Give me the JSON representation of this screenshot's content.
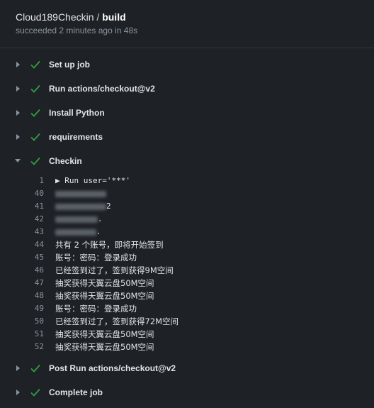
{
  "header": {
    "repo": "Cloud189Checkin",
    "separator": "/",
    "workflow": "build",
    "status": "succeeded 2 minutes ago in 48s"
  },
  "colors": {
    "success": "#2ea043",
    "background": "#1e2227"
  },
  "steps_before": [
    {
      "label": "Set up job",
      "icon": "check-icon"
    },
    {
      "label": "Run actions/checkout@v2",
      "icon": "check-icon"
    },
    {
      "label": "Install Python",
      "icon": "check-icon"
    },
    {
      "label": "requirements",
      "icon": "check-icon"
    }
  ],
  "checkin_step": {
    "label": "Checkin",
    "expanded": true
  },
  "log": {
    "run_line": {
      "num": "1",
      "text": "▶ Run user='***'"
    },
    "redacted": [
      {
        "num": "40",
        "tail": ""
      },
      {
        "num": "41",
        "tail": "2"
      },
      {
        "num": "42",
        "tail": "."
      },
      {
        "num": "43",
        "tail": "."
      }
    ],
    "lines": [
      {
        "num": "44",
        "text": "共有 2 个账号，即将开始签到"
      },
      {
        "num": "45",
        "text": "账号：密码：登录成功"
      },
      {
        "num": "46",
        "text": "已经签到过了，签到获得9M空间"
      },
      {
        "num": "47",
        "text": "抽奖获得天翼云盘50M空间"
      },
      {
        "num": "48",
        "text": "抽奖获得天翼云盘50M空间"
      },
      {
        "num": "49",
        "text": "账号：密码：登录成功"
      },
      {
        "num": "50",
        "text": "已经签到过了，签到获得72M空间"
      },
      {
        "num": "51",
        "text": "抽奖获得天翼云盘50M空间"
      },
      {
        "num": "52",
        "text": "抽奖获得天翼云盘50M空间"
      }
    ]
  },
  "steps_after": [
    {
      "label": "Post Run actions/checkout@v2",
      "icon": "check-icon"
    },
    {
      "label": "Complete job",
      "icon": "check-icon"
    }
  ]
}
